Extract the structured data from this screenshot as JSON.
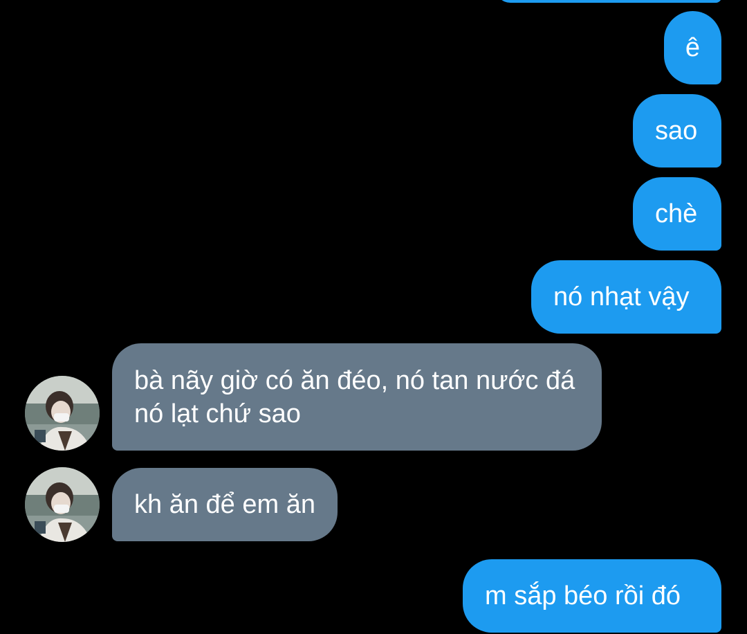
{
  "conversation": {
    "messages": [
      {
        "sender": "me",
        "text": "ê"
      },
      {
        "sender": "me",
        "text": "sao"
      },
      {
        "sender": "me",
        "text": "chè"
      },
      {
        "sender": "me",
        "text": "nó nhạt vậy"
      },
      {
        "sender": "other",
        "text": "bà nãy giờ có ăn đéo, nó tan nước đá nó lạt chứ sao"
      },
      {
        "sender": "other",
        "text": "kh ăn để em ăn"
      },
      {
        "sender": "me",
        "text": "m sắp béo rồi đó"
      }
    ]
  },
  "colors": {
    "background": "#000000",
    "outgoing_bubble": "#1d9bf0",
    "incoming_bubble": "#66798a",
    "text": "#ffffff"
  },
  "icons": {
    "avatar": "contact-avatar-photo"
  }
}
